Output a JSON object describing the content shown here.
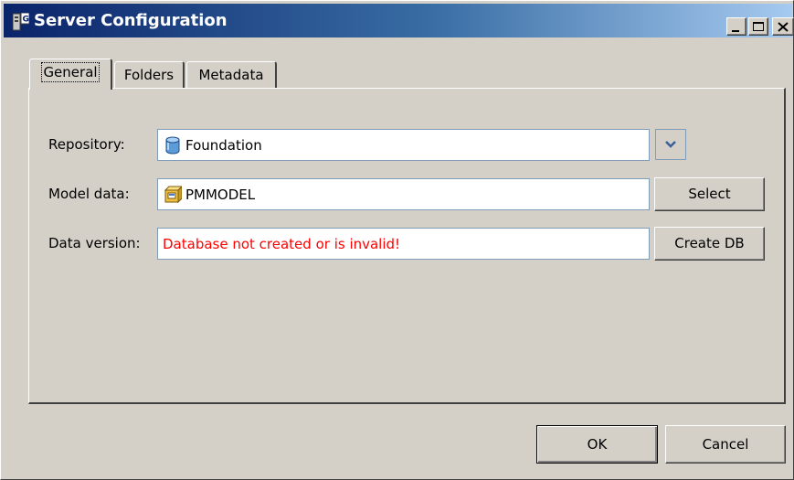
{
  "window": {
    "title": "Server Configuration"
  },
  "tabs": [
    {
      "label": "General",
      "active": true
    },
    {
      "label": "Folders",
      "active": false
    },
    {
      "label": "Metadata",
      "active": false
    }
  ],
  "form": {
    "repository": {
      "label": "Repository:",
      "value": "Foundation",
      "icon": "database-icon"
    },
    "model_data": {
      "label": "Model data:",
      "value": "PMMODEL",
      "icon": "model-package-icon",
      "button": "Select"
    },
    "data_version": {
      "label": "Data version:",
      "value": "Database not created or is invalid!",
      "value_color": "#ff0000",
      "button": "Create DB"
    }
  },
  "buttons": {
    "ok": "OK",
    "cancel": "Cancel"
  },
  "colors": {
    "titlebar_start": "#0a246a",
    "titlebar_end": "#a6caf0",
    "window_bg": "#d4d0c8",
    "error": "#ff0000"
  }
}
